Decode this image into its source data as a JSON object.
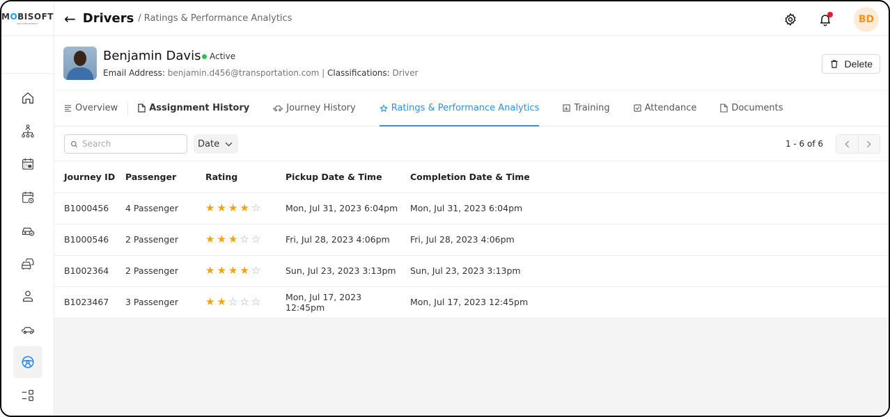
{
  "brand": {
    "logo_text_pre": "M",
    "logo_text_o": "O",
    "logo_text_post": "BISOFT",
    "logo_sub": "DISCOVER MOBILITY"
  },
  "header": {
    "title": "Drivers",
    "breadcrumb": "/ Ratings & Performance Analytics",
    "avatar_initials": "BD"
  },
  "colors": {
    "accent": "#2f8ff0",
    "star_on": "#f6a10c",
    "active_dot": "#2ec14a",
    "notification_dot": "#e8192c",
    "avatar_bg": "#fdebd6",
    "avatar_fg": "#f2931c"
  },
  "sidebar": {
    "items": [
      {
        "icon": "home-icon",
        "active": false
      },
      {
        "icon": "org-chart-icon",
        "active": false
      },
      {
        "icon": "calendar-icon",
        "active": false
      },
      {
        "icon": "calendar-clock-icon",
        "active": false
      },
      {
        "icon": "car-check-icon",
        "active": false
      },
      {
        "icon": "fleet-icon",
        "active": false
      },
      {
        "icon": "user-icon",
        "active": false
      },
      {
        "icon": "car-icon",
        "active": false
      },
      {
        "icon": "steering-wheel-icon",
        "active": true
      },
      {
        "icon": "list-settings-icon",
        "active": false
      }
    ]
  },
  "profile": {
    "name": "Benjamin Davis",
    "status": "Active",
    "email_label": "Email Address:",
    "email": "benjamin.d456@transportation.com",
    "separator": "|",
    "class_label": "Classifications:",
    "classification": "Driver",
    "delete_label": "Delete"
  },
  "tabs": [
    {
      "label": "Overview",
      "icon": "lines-icon"
    },
    {
      "label": "Assignment History",
      "icon": "file-icon"
    },
    {
      "label": "Journey History",
      "icon": "car-icon"
    },
    {
      "label": "Ratings & Performance Analytics",
      "icon": "star-icon",
      "active": true
    },
    {
      "label": "Training",
      "icon": "chart-icon"
    },
    {
      "label": "Attendance",
      "icon": "checkbox-icon"
    },
    {
      "label": "Documents",
      "icon": "file-icon"
    }
  ],
  "filters": {
    "search_placeholder": "Search",
    "search_value": "",
    "date_label": "Date",
    "pagination": "1 - 6 of 6"
  },
  "table": {
    "columns": [
      "Journey ID",
      "Passenger",
      "Rating",
      "Pickup Date & Time",
      "Completion Date & Time"
    ],
    "max_rating": 5,
    "rows": [
      {
        "id": "B1000456",
        "passenger": "4 Passenger",
        "rating": 4,
        "pickup": "Mon, Jul 31, 2023 6:04pm",
        "completion": "Mon, Jul 31, 2023 6:04pm"
      },
      {
        "id": "B1000546",
        "passenger": "2 Passenger",
        "rating": 3,
        "pickup": "Fri, Jul 28, 2023 4:06pm",
        "completion": "Fri, Jul 28, 2023 4:06pm"
      },
      {
        "id": "B1002364",
        "passenger": "2 Passenger",
        "rating": 4,
        "pickup": "Sun, Jul 23, 2023 3:13pm",
        "completion": "Sun, Jul 23, 2023 3:13pm"
      },
      {
        "id": "B1023467",
        "passenger": "3 Passenger",
        "rating": 2,
        "pickup": "Mon, Jul 17, 2023 12:45pm",
        "completion": "Mon, Jul 17, 2023 12:45pm"
      }
    ]
  }
}
